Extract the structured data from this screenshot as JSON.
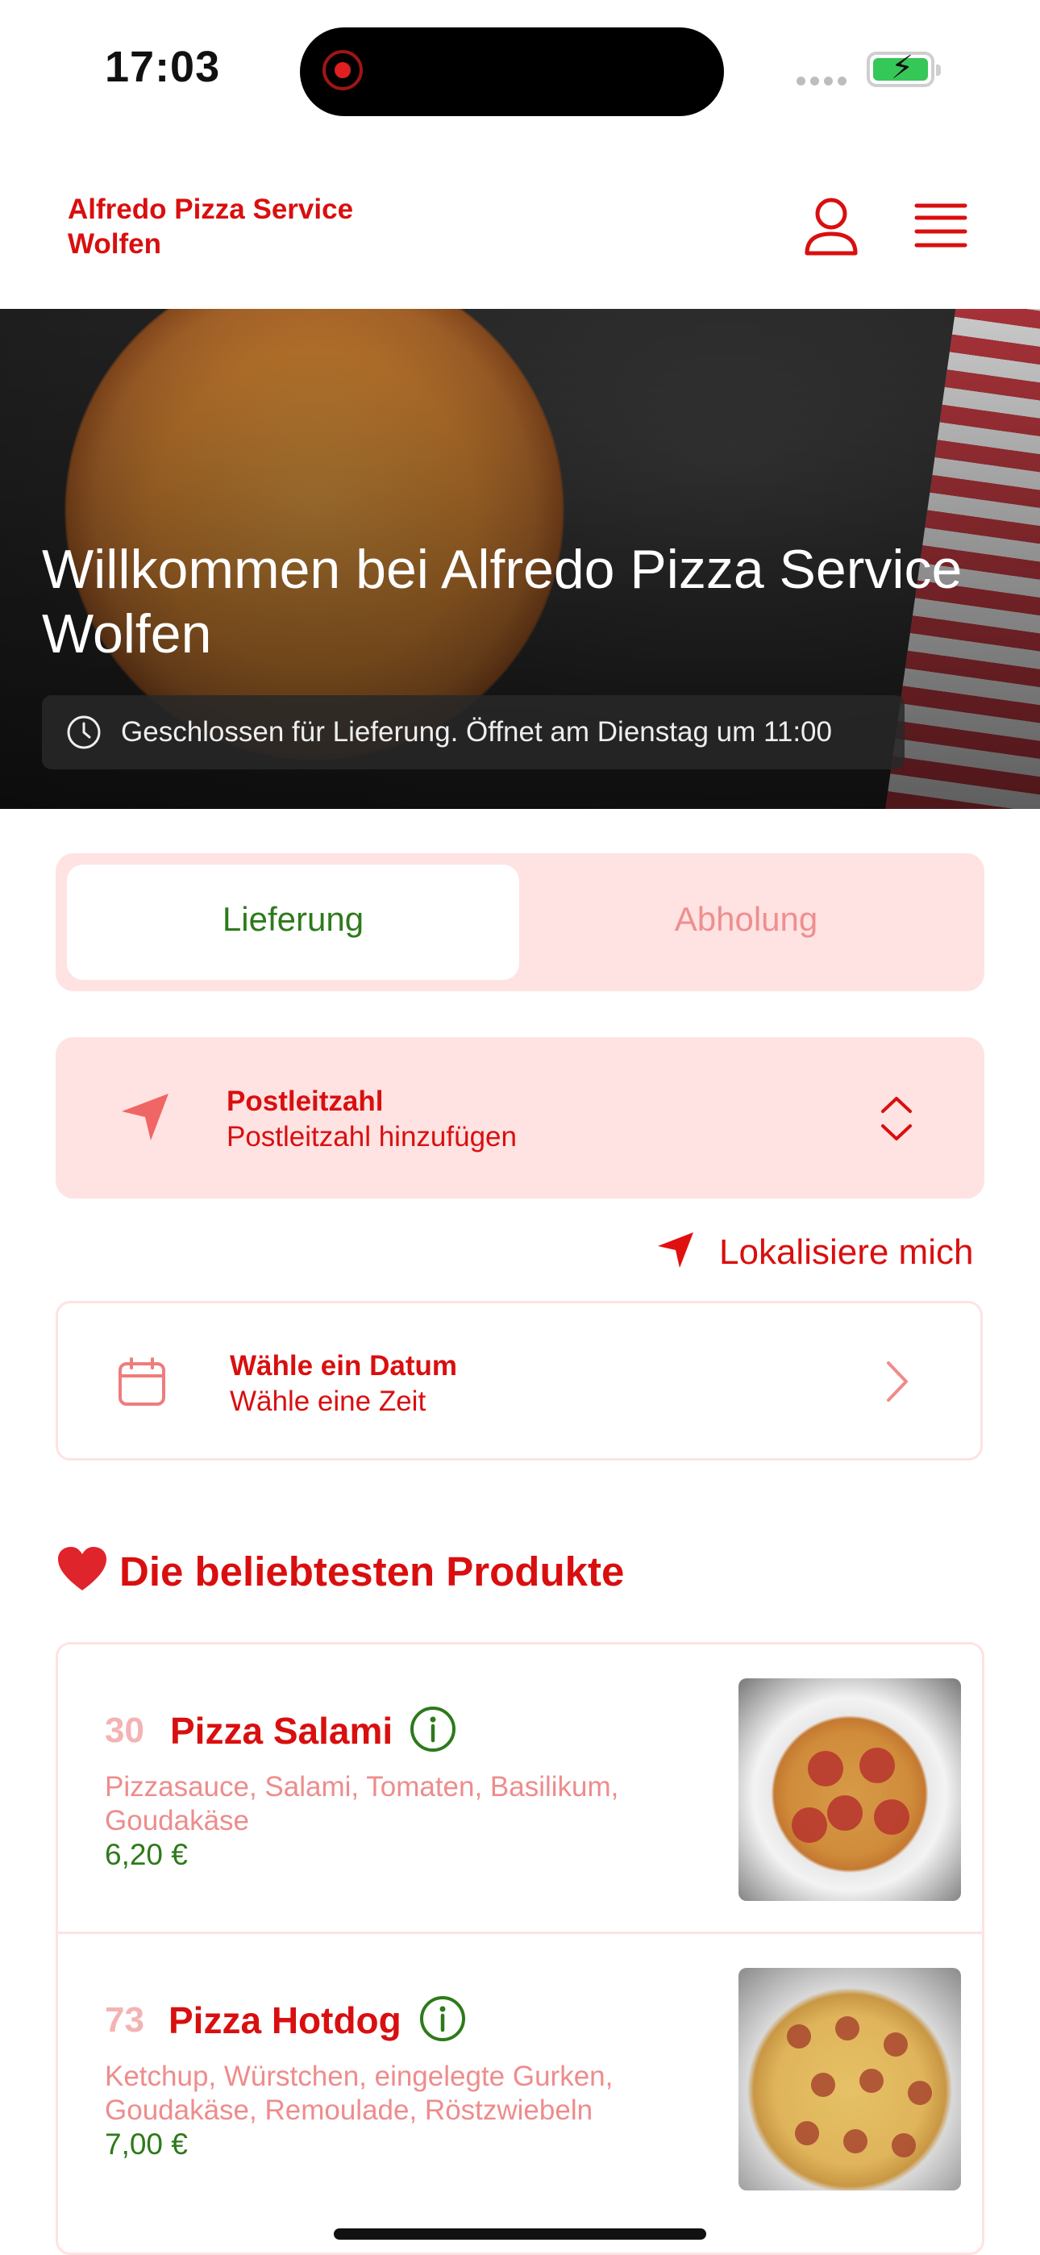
{
  "status_bar": {
    "time": "17:03"
  },
  "header": {
    "brand_line1": "Alfredo Pizza Service",
    "brand_line2": "Wolfen"
  },
  "hero": {
    "title": "Willkommen bei Alfredo Pizza Service Wolfen",
    "status": "Geschlossen für Lieferung. Öffnet am Dienstag um 11:00"
  },
  "order_mode": {
    "options": [
      "Lieferung",
      "Abholung"
    ],
    "selected": "Lieferung"
  },
  "postcode": {
    "label": "Postleitzahl",
    "placeholder": "Postleitzahl hinzufügen"
  },
  "locate": {
    "label": "Lokalisiere mich"
  },
  "schedule": {
    "date_label": "Wähle ein Datum",
    "time_label": "Wähle eine Zeit"
  },
  "popular": {
    "title": "Die beliebtesten Produkte",
    "items": [
      {
        "number": "30",
        "name": "Pizza Salami",
        "description": "Pizzasauce, Salami, Tomaten, Basilikum, Goudakäse",
        "price": "6,20 €"
      },
      {
        "number": "73",
        "name": "Pizza Hotdog",
        "description": "Ketchup, Würstchen, eingelegte Gurken, Goudakäse, Remoulade, Röstzwiebeln",
        "price": "7,00 €"
      }
    ]
  },
  "colors": {
    "brand_red": "#d90f0f",
    "pink_bg": "#ffe2e2",
    "price_green": "#2d7a1a"
  },
  "icons": [
    "user-icon",
    "menu-icon",
    "clock-icon",
    "navigation-arrow-icon",
    "sort-chevrons-icon",
    "calendar-icon",
    "chevron-right-icon",
    "heart-icon",
    "info-icon"
  ]
}
